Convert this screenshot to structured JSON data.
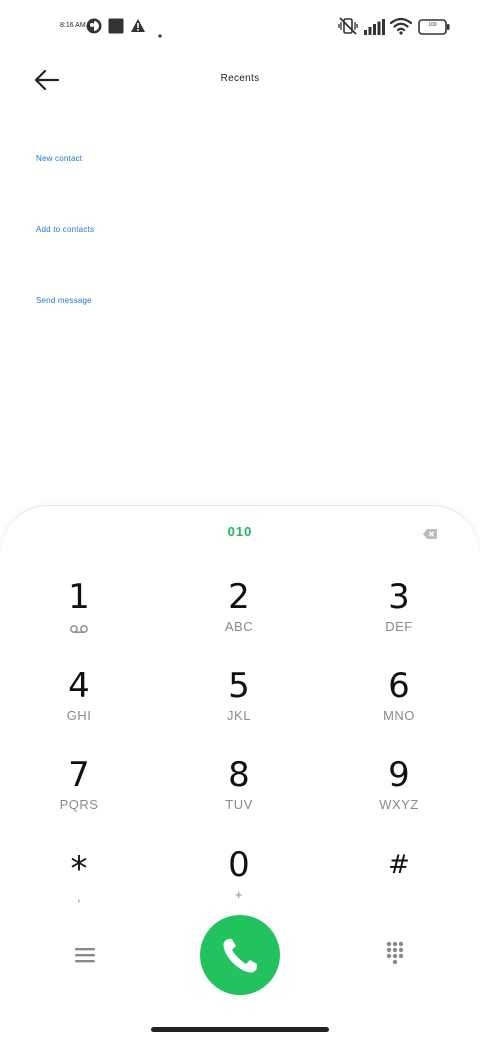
{
  "status_bar": {
    "time": "8:16 AM",
    "battery_level": "100"
  },
  "header": {
    "title": "Recents"
  },
  "actions": [
    {
      "label": "New contact"
    },
    {
      "label": "Add to contacts"
    },
    {
      "label": "Send message"
    }
  ],
  "dialer": {
    "number": "010",
    "keys": [
      {
        "digit": "1",
        "letters": ""
      },
      {
        "digit": "2",
        "letters": "ABC"
      },
      {
        "digit": "3",
        "letters": "DEF"
      },
      {
        "digit": "4",
        "letters": "GHI"
      },
      {
        "digit": "5",
        "letters": "JKL"
      },
      {
        "digit": "6",
        "letters": "MNO"
      },
      {
        "digit": "7",
        "letters": "PQRS"
      },
      {
        "digit": "8",
        "letters": "TUV"
      },
      {
        "digit": "9",
        "letters": "WXYZ"
      },
      {
        "digit": "*",
        "letters": ","
      },
      {
        "digit": "0",
        "letters": "+"
      },
      {
        "digit": "#",
        "letters": ""
      }
    ]
  },
  "colors": {
    "accent_green": "#22c35e",
    "link_blue": "#1c7ad4"
  },
  "icons": {
    "back": "arrow-left-icon",
    "backspace": "backspace-icon",
    "voicemail": "voicemail-icon",
    "menu": "menu-icon",
    "call": "phone-icon",
    "keypad": "keypad-icon"
  }
}
